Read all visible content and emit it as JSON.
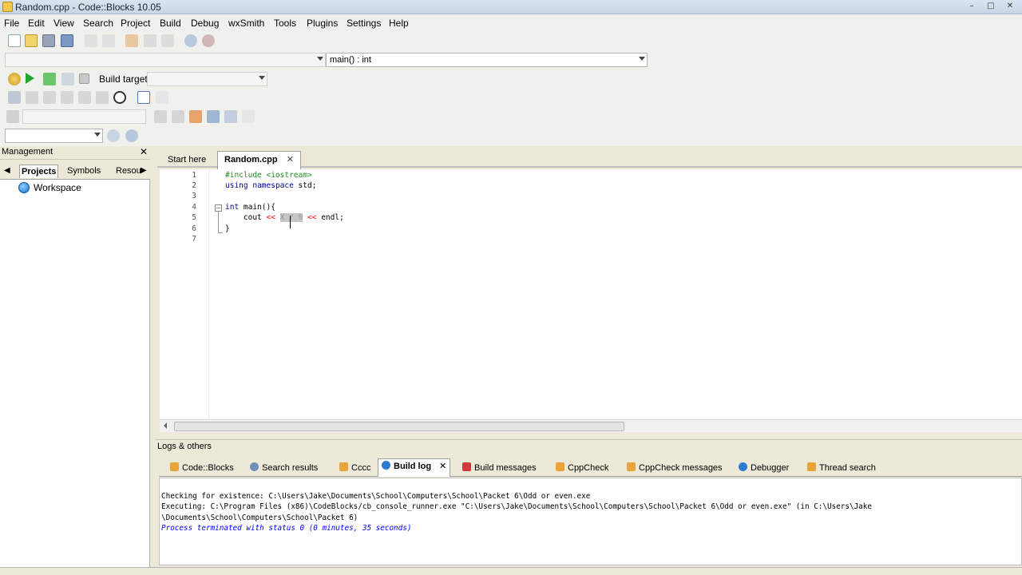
{
  "window": {
    "title": "Random.cpp - Code::Blocks 10.05",
    "controls": [
      "–",
      "□",
      "✕"
    ]
  },
  "menu": [
    "File",
    "Edit",
    "View",
    "Search",
    "Project",
    "Build",
    "Debug",
    "wxSmith",
    "Tools",
    "Plugins",
    "Settings",
    "Help"
  ],
  "toolbar": {
    "scope_combo": "",
    "function_combo": "main() : int",
    "build_target_label": "Build target:",
    "build_target_value": ""
  },
  "management": {
    "title": "Management",
    "close": "✕",
    "tabs": [
      "Projects",
      "Symbols",
      "Resou"
    ],
    "tree": {
      "workspace": "Workspace"
    }
  },
  "editor": {
    "tabs": [
      {
        "label": "Start here",
        "active": false
      },
      {
        "label": "Random.cpp",
        "active": true,
        "close": "✕"
      }
    ],
    "line_numbers": [
      "1",
      "2",
      "3",
      "4",
      "5",
      "6",
      "7"
    ],
    "code": {
      "l1_pp": "#include <iostream>",
      "l2_kw1": "using",
      "l2_kw2": "namespace",
      "l2_rest": " std;",
      "l4_kw": "int",
      "l4_rest": " main(){",
      "l5_a": "    cout ",
      "l5_op1": "<<",
      "l5_sp": " ",
      "l5_sel": "X / 0",
      "l5_sp2": " ",
      "l5_op2": "<<",
      "l5_b": " endl;",
      "l6": "}"
    }
  },
  "logs": {
    "title": "Logs & others",
    "tabs": [
      {
        "label": "Code::Blocks",
        "color": "#e8a33a"
      },
      {
        "label": "Search results",
        "color": "#6f8fb8"
      },
      {
        "label": "Cccc",
        "color": "#e8a33a"
      },
      {
        "label": "Build log",
        "color": "#2b7bd0",
        "active": true,
        "close": "✕"
      },
      {
        "label": "Build messages",
        "color": "#d23b3b"
      },
      {
        "label": "CppCheck",
        "color": "#e8a33a"
      },
      {
        "label": "CppCheck messages",
        "color": "#e8a33a"
      },
      {
        "label": "Debugger",
        "color": "#2b7bd0"
      },
      {
        "label": "Thread search",
        "color": "#e8a33a"
      }
    ],
    "lines": [
      "Checking for existence: C:\\Users\\Jake\\Documents\\School\\Computers\\School\\Packet 6\\Odd or even.exe",
      "Executing: C:\\Program Files (x86)\\CodeBlocks/cb_console_runner.exe \"C:\\Users\\Jake\\Documents\\School\\Computers\\School\\Packet 6\\Odd or even.exe\" (in C:\\Users\\Jake",
      "\\Documents\\School\\Computers\\School\\Packet 6)",
      "Process terminated with status 0 (0 minutes, 35 seconds)"
    ]
  },
  "colors": {
    "keyword": "#00008b",
    "preprocessor": "#228b22",
    "operator": "#ff0000",
    "log_status": "#0000ff"
  }
}
